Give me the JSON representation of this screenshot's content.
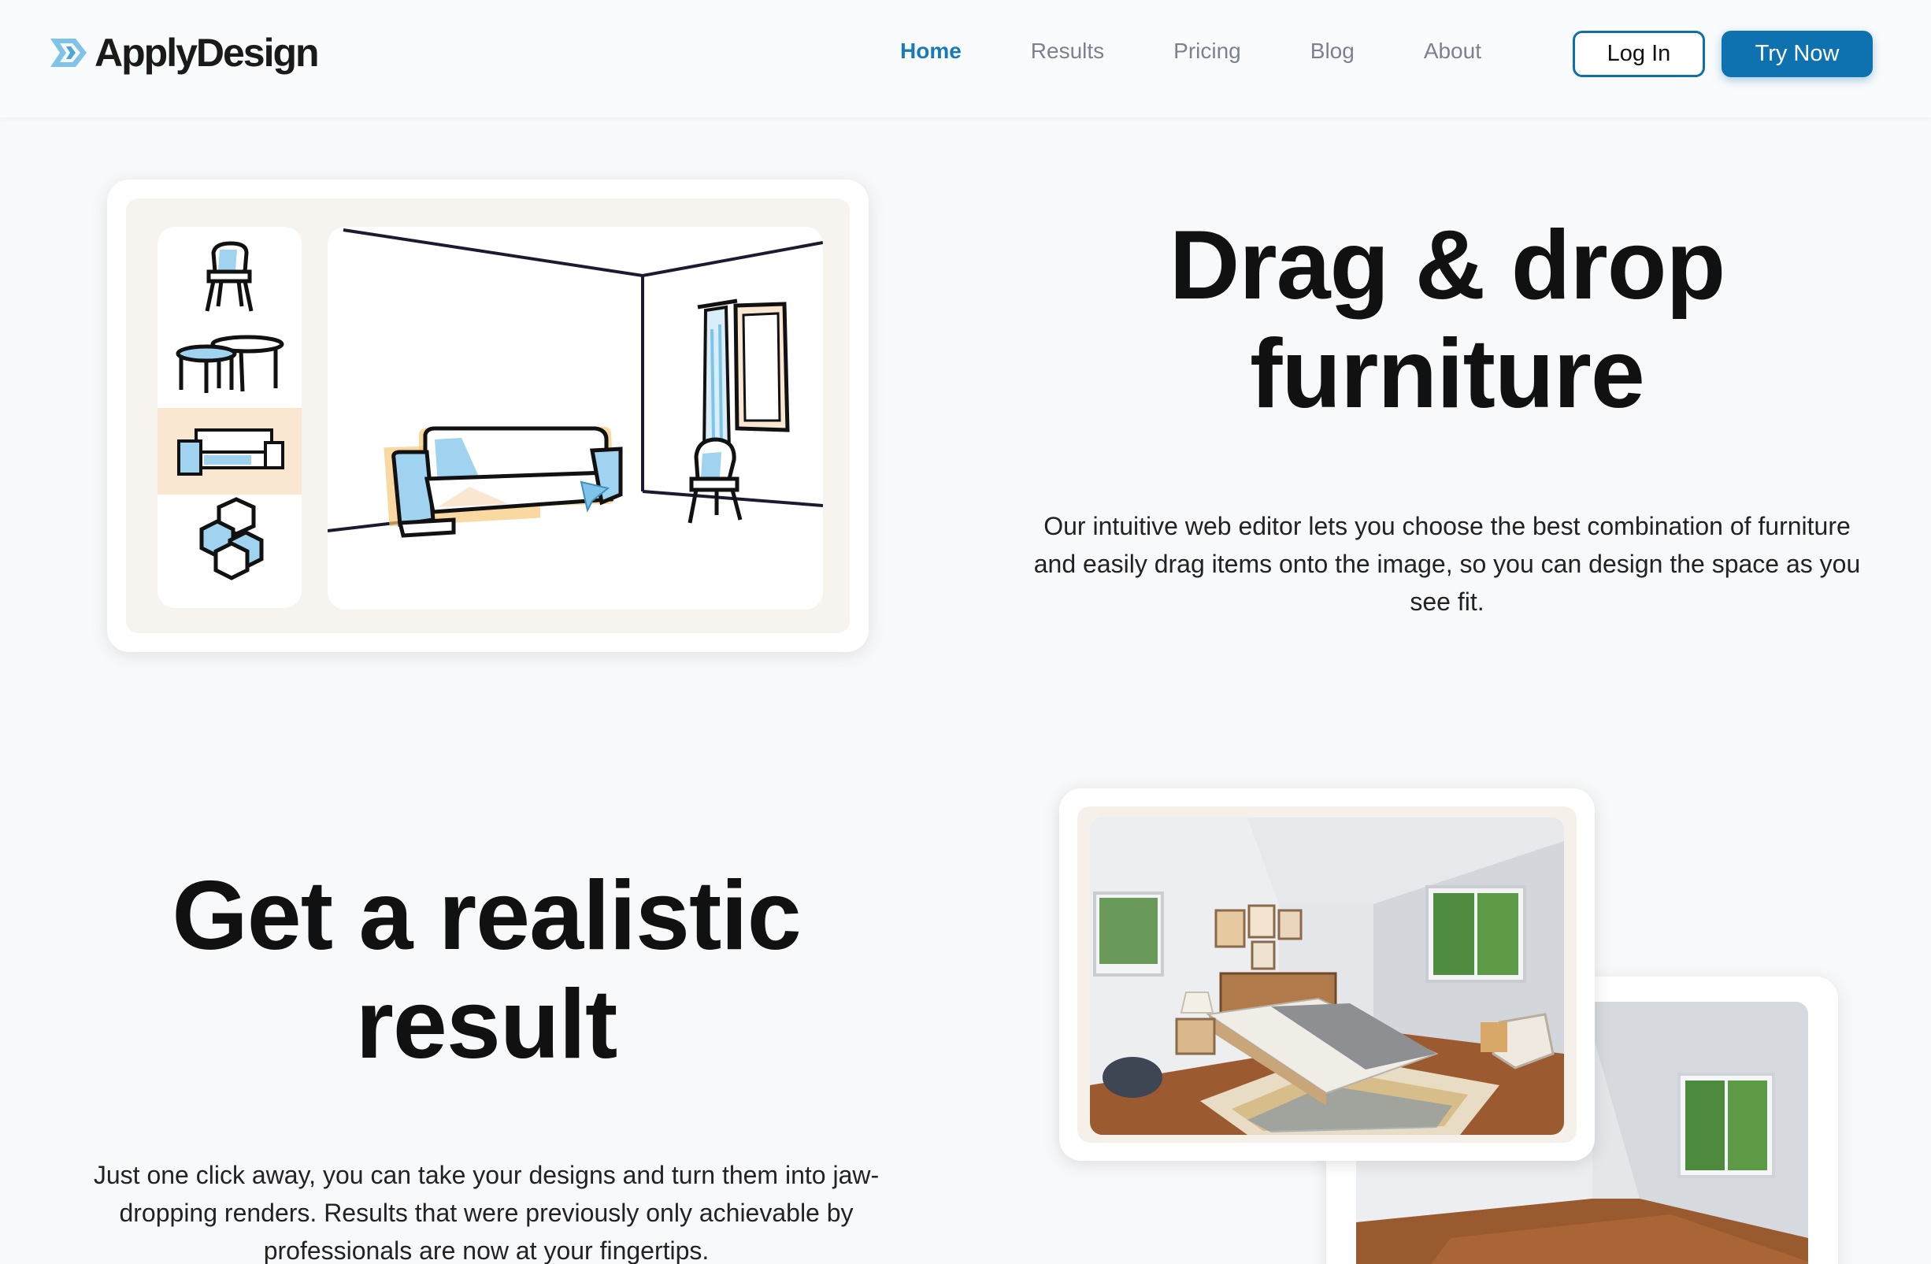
{
  "brand": {
    "name": "ApplyDesign",
    "primary_color": "#0e72b0"
  },
  "nav": {
    "items": [
      {
        "label": "Home",
        "active": true
      },
      {
        "label": "Results",
        "active": false
      },
      {
        "label": "Pricing",
        "active": false
      },
      {
        "label": "Blog",
        "active": false
      },
      {
        "label": "About",
        "active": false
      }
    ],
    "login_label": "Log In",
    "try_label": "Try Now"
  },
  "editor": {
    "palette_items": [
      "chair-icon",
      "table-icon",
      "sofa-icon",
      "hexagon-shelf-icon"
    ],
    "selected_item": "sofa-icon"
  },
  "section_drag": {
    "title_line1": "Drag & drop",
    "title_line2": "furniture",
    "body": "Our intuitive web editor lets you choose the best combination of furniture and easily drag items onto the image, so you can design the space as you see fit."
  },
  "section_realistic": {
    "title_line1": "Get a realistic",
    "title_line2": "result",
    "body": "Just one click away, you can take your designs and turn them into jaw-dropping renders. Results that were previously only achievable by professionals are now at your fingertips."
  }
}
